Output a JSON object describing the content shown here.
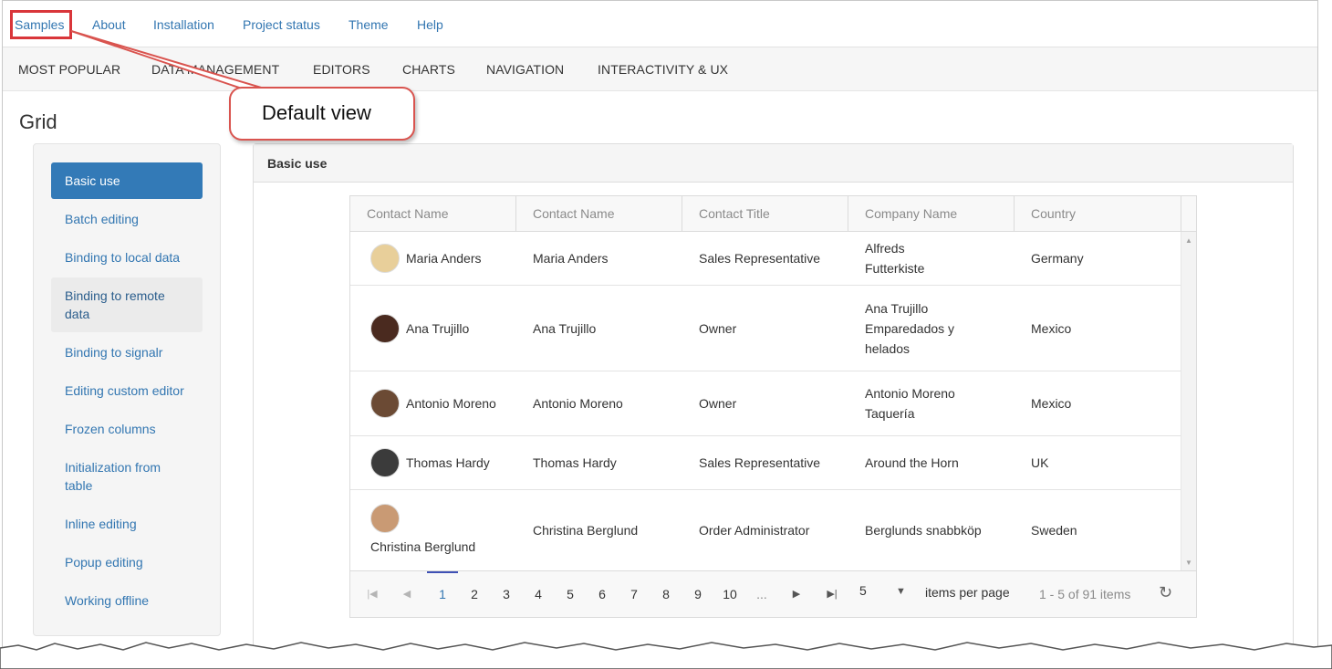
{
  "topnav": [
    "Samples",
    "About",
    "Installation",
    "Project status",
    "Theme",
    "Help"
  ],
  "categories": [
    "MOST POPULAR",
    "DATA MANAGEMENT",
    "EDITORS",
    "CHARTS",
    "NAVIGATION",
    "INTERACTIVITY & UX"
  ],
  "callout": "Default view",
  "page_title": "Grid",
  "sidebar": [
    "Basic use",
    "Batch editing",
    "Binding to local data",
    "Binding to remote data",
    "Binding to signalr",
    "Editing custom editor",
    "Frozen columns",
    "Initialization from table",
    "Inline editing",
    "Popup editing",
    "Working offline"
  ],
  "panel_title": "Basic use",
  "columns": [
    "Contact Name",
    "Contact Name",
    "Contact Title",
    "Company Name",
    "Country"
  ],
  "rows": [
    {
      "name": "Maria Anders",
      "contact": "Maria Anders",
      "title": "Sales Representative",
      "company": "Alfreds Futterkiste",
      "country": "Germany",
      "avatar_color": "#e8cf9a"
    },
    {
      "name": "Ana Trujillo",
      "contact": "Ana Trujillo",
      "title": "Owner",
      "company": "Ana Trujillo Emparedados y helados",
      "country": "Mexico",
      "avatar_color": "#4a2a1f"
    },
    {
      "name": "Antonio Moreno",
      "contact": "Antonio Moreno",
      "title": "Owner",
      "company": "Antonio Moreno Taquería",
      "country": "Mexico",
      "avatar_color": "#6b4a34"
    },
    {
      "name": "Thomas Hardy",
      "contact": "Thomas Hardy",
      "title": "Sales Representative",
      "company": "Around the Horn",
      "country": "UK",
      "avatar_color": "#3b3b3b"
    },
    {
      "name": "Christina Berglund",
      "contact": "Christina Berglund",
      "title": "Order Administrator",
      "company": "Berglunds snabbköp",
      "country": "Sweden",
      "avatar_color": "#c99a74"
    }
  ],
  "pager": {
    "pages": [
      "1",
      "2",
      "3",
      "4",
      "5",
      "6",
      "7",
      "8",
      "9",
      "10",
      "..."
    ],
    "current": "1",
    "page_size": "5",
    "items_per_page": "items per page",
    "info": "1 - 5 of 91 items"
  },
  "colors": {
    "link": "#3276b1",
    "active": "#337ab7",
    "callout_border": "#d9544f"
  }
}
